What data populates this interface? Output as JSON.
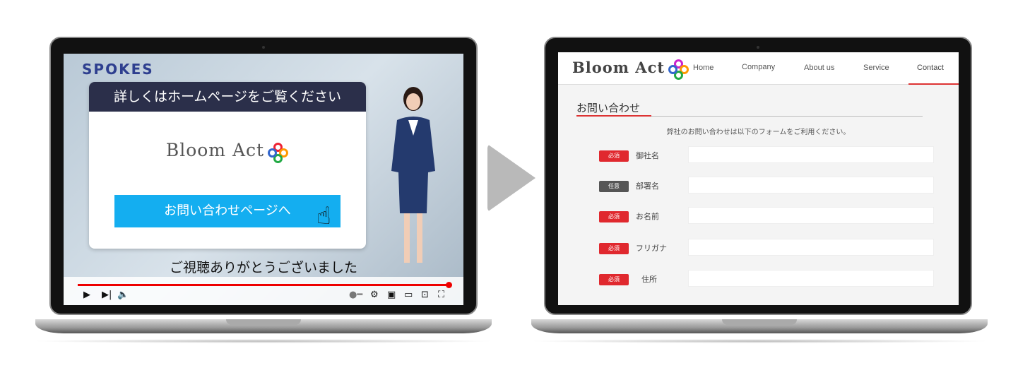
{
  "video": {
    "brand": "SPOKES",
    "card_heading": "詳しくはホームページをご覧ください",
    "logo_text": "Bloom Act",
    "cta_label": "お問い合わせページへ",
    "caption": "ご視聴ありがとうございました",
    "progress_percent": 100,
    "controls": [
      "play-icon",
      "next-icon",
      "volume-icon",
      "autoplay-toggle-icon",
      "settings-icon",
      "miniplayer-icon",
      "theater-icon",
      "cast-icon",
      "fullscreen-icon"
    ],
    "accent_color": "#14aef0",
    "progress_color": "#e00000"
  },
  "site": {
    "logo_text": "Bloom Act",
    "nav": [
      "Home",
      "Company",
      "About us",
      "Service",
      "Contact"
    ],
    "active_nav": "Contact",
    "heading": "お問い合わせ",
    "intro": "弊社のお問い合わせは以下のフォームをご利用ください。",
    "fields": [
      {
        "badge": "必須",
        "label": "御社名",
        "value": ""
      },
      {
        "badge": "任意",
        "label": "部署名",
        "value": ""
      },
      {
        "badge": "必須",
        "label": "お名前",
        "value": ""
      },
      {
        "badge": "必須",
        "label": "フリガナ",
        "value": ""
      },
      {
        "badge": "必須",
        "label": "住所",
        "value": ""
      }
    ],
    "required_color": "#e0282e",
    "optional_color": "#555555"
  }
}
